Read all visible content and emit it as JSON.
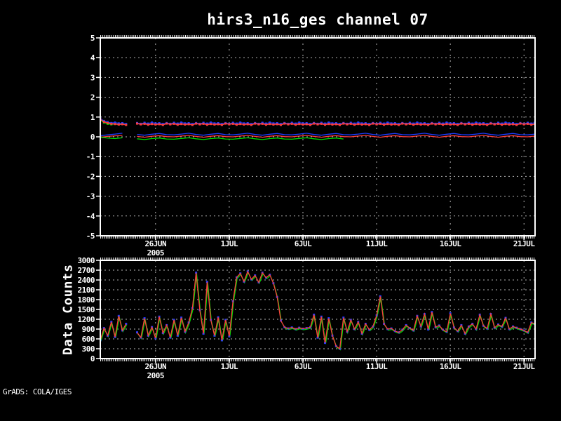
{
  "footer": {
    "grads": "GrADS: COLA/IGES"
  },
  "colors": {
    "background": "#000000",
    "frame": "#ffffff",
    "grid": "#b4b4b4",
    "text": "#ffffff",
    "red": "#fa3c3c",
    "green": "#00dc00",
    "blue": "#1e3cff"
  },
  "chart_data": [
    {
      "id": "ges-departures",
      "type": "line",
      "panel": "top",
      "title": "hirs3_n16_ges channel 07",
      "ylim": [
        -5,
        5
      ],
      "yticks": [
        5,
        4,
        3,
        2,
        1,
        0,
        -1,
        -2,
        -3,
        -4,
        -5
      ],
      "xlim_days": [
        -3.75,
        25.75
      ],
      "xticks": [
        {
          "day": 0,
          "label": "26JUN",
          "sublabel": "2005"
        },
        {
          "day": 5,
          "label": "1JUL"
        },
        {
          "day": 10,
          "label": "6JUL"
        },
        {
          "day": 15,
          "label": "11JUL"
        },
        {
          "day": 20,
          "label": "16JUL"
        },
        {
          "day": 25,
          "label": "21JUL"
        }
      ],
      "grid": true,
      "series": [
        {
          "name": "obs-band-green",
          "color": "#00dc00",
          "line": true,
          "marker": true,
          "x0": -3.75,
          "dx": 0.25,
          "values": [
            0.85,
            0.72,
            0.66,
            0.63,
            0.65,
            0.62,
            0.64,
            0.62
          ]
        },
        {
          "name": "obs-band-blue",
          "color": "#1e3cff",
          "line": true,
          "marker": true,
          "x0": -3.75,
          "dx": 0.25,
          "values": [
            0.92,
            0.8,
            0.74,
            0.7,
            0.72,
            0.68,
            0.69,
            0.65,
            null,
            null,
            0.7,
            0.66,
            0.71,
            0.67,
            0.72,
            0.68,
            0.69,
            0.65,
            0.7,
            0.66,
            0.71,
            0.67,
            0.72,
            0.68,
            0.69,
            0.65,
            0.7,
            0.66,
            0.71,
            0.67,
            0.72,
            0.68,
            0.69,
            0.65,
            0.7,
            0.66,
            0.71,
            0.67,
            0.72,
            0.68,
            0.69,
            0.65,
            0.7,
            0.66,
            0.71,
            0.67,
            0.72,
            0.68,
            0.69,
            0.65,
            0.7,
            0.66,
            0.71,
            0.67,
            0.72,
            0.68,
            0.69,
            0.65,
            0.7,
            0.66,
            0.71,
            0.67,
            0.72,
            0.68,
            0.69,
            0.65,
            0.7,
            0.66,
            0.71,
            0.67,
            0.72,
            0.68,
            0.69,
            0.65,
            0.7,
            0.66,
            0.71,
            0.67,
            0.72,
            0.68,
            0.69,
            0.65,
            0.7,
            0.66,
            0.71,
            0.67,
            0.72,
            0.68,
            0.69,
            0.65,
            0.7,
            0.66,
            0.71,
            0.67,
            0.72,
            0.68,
            0.69,
            0.65,
            0.7,
            0.66,
            0.71,
            0.67,
            0.72,
            0.68,
            0.69,
            0.65,
            0.7,
            0.66,
            0.71,
            0.67,
            0.72,
            0.68,
            0.69,
            0.65,
            0.7,
            0.66,
            0.71,
            0.67,
            0.72
          ]
        },
        {
          "name": "obs-band-red",
          "color": "#fa3c3c",
          "line": true,
          "marker": true,
          "x0": -3.75,
          "dx": 0.25,
          "values": [
            0.88,
            0.76,
            0.7,
            0.66,
            0.65,
            0.62,
            0.64,
            0.6,
            null,
            null,
            0.67,
            0.63,
            0.66,
            0.61,
            0.65,
            0.62,
            0.64,
            0.6,
            0.67,
            0.63,
            0.66,
            0.61,
            0.65,
            0.62,
            0.64,
            0.6,
            0.67,
            0.63,
            0.66,
            0.61,
            0.65,
            0.62,
            0.64,
            0.6,
            0.67,
            0.63,
            0.66,
            0.61,
            0.65,
            0.62,
            0.64,
            0.6,
            0.67,
            0.63,
            0.66,
            0.61,
            0.65,
            0.62,
            0.64,
            0.6,
            0.67,
            0.63,
            0.66,
            0.61,
            0.65,
            0.62,
            0.64,
            0.6,
            0.67,
            0.63,
            0.66,
            0.61,
            0.65,
            0.62,
            0.64,
            0.6,
            0.67,
            0.63,
            0.66,
            0.61,
            0.65,
            0.62,
            0.64,
            0.6,
            0.67,
            0.63,
            0.66,
            0.61,
            0.65,
            0.62,
            0.64,
            0.6,
            0.67,
            0.63,
            0.66,
            0.61,
            0.65,
            0.62,
            0.64,
            0.6,
            0.67,
            0.63,
            0.66,
            0.61,
            0.65,
            0.62,
            0.64,
            0.6,
            0.67,
            0.63,
            0.66,
            0.61,
            0.65,
            0.62,
            0.64,
            0.6,
            0.67,
            0.63,
            0.66,
            0.61,
            0.65,
            0.62,
            0.64,
            0.6,
            0.67,
            0.63,
            0.66,
            0.61,
            0.65
          ]
        },
        {
          "name": "bias-blue",
          "color": "#1e3cff",
          "line": true,
          "marker": false,
          "x0": -3.75,
          "dx": 0.5,
          "values": [
            0.06,
            0.1,
            0.14,
            0.18,
            null,
            0.12,
            0.08,
            0.13,
            0.17,
            0.11,
            0.1,
            0.14,
            0.18,
            0.12,
            0.08,
            0.13,
            0.17,
            0.11,
            0.1,
            0.14,
            0.18,
            0.12,
            0.08,
            0.13,
            0.17,
            0.11,
            0.1,
            0.14,
            0.18,
            0.12,
            0.08,
            0.13,
            0.17,
            0.11,
            0.1,
            0.14,
            0.18,
            0.12,
            0.08,
            0.13,
            0.17,
            0.11,
            0.1,
            0.14,
            0.18,
            0.12,
            0.08,
            0.13,
            0.17,
            0.11,
            0.1,
            0.14,
            0.18,
            0.12,
            0.08,
            0.13,
            0.17,
            0.11,
            0.1,
            0.14
          ]
        },
        {
          "name": "bias-red",
          "color": "#fa3c3c",
          "line": true,
          "marker": false,
          "x0": -3.75,
          "dx": 0.5,
          "values": [
            -0.02,
            0.02,
            0.05,
            0.07,
            null,
            0.02,
            -0.02,
            0.03,
            0.06,
            0.01,
            0,
            0.04,
            0.07,
            0.02,
            -0.02,
            0.03,
            0.06,
            0.01,
            0,
            0.04,
            0.07,
            0.02,
            -0.02,
            0.03,
            0.06,
            0.01,
            0,
            0.04,
            0.07,
            0.02,
            -0.02,
            0.03,
            0.06,
            0.01,
            0,
            0.04,
            0.07,
            0.02,
            -0.02,
            0.03,
            0.06,
            0.01,
            0,
            0.04,
            0.07,
            0.02,
            -0.02,
            0.03,
            0.06,
            0.01,
            0,
            0.04,
            0.07,
            0.02,
            -0.02,
            0.03,
            0.06,
            0.01,
            0,
            0.04
          ]
        },
        {
          "name": "bias-green",
          "color": "#00dc00",
          "line": true,
          "marker": false,
          "x0": -3.75,
          "dx": 0.5,
          "values": [
            -0.02,
            -0.06,
            -0.09,
            -0.05,
            null,
            -0.1,
            -0.14,
            -0.09,
            -0.06,
            -0.11,
            -0.12,
            -0.08,
            -0.05,
            -0.1,
            -0.14,
            -0.09,
            -0.06,
            -0.11,
            -0.12,
            -0.08,
            -0.05,
            -0.1,
            -0.14,
            -0.09,
            -0.06,
            -0.11,
            -0.12,
            -0.08,
            -0.05,
            -0.1,
            -0.14,
            -0.09,
            -0.06,
            -0.11
          ]
        }
      ]
    },
    {
      "id": "data-counts",
      "type": "line",
      "panel": "bottom",
      "ylabel": "Data Counts",
      "ylim": [
        0,
        3000
      ],
      "yticks": [
        3000,
        2700,
        2400,
        2100,
        1800,
        1500,
        1200,
        900,
        600,
        300,
        0
      ],
      "xticks": [
        {
          "day": 0,
          "label": "26JUN",
          "sublabel": "2005"
        },
        {
          "day": 5,
          "label": "1JUL"
        },
        {
          "day": 10,
          "label": "6JUL"
        },
        {
          "day": 15,
          "label": "11JUL"
        },
        {
          "day": 20,
          "label": "16JUL"
        },
        {
          "day": 25,
          "label": "21JUL"
        }
      ],
      "grid": true,
      "series": [
        {
          "name": "counts",
          "color": "#00dc00",
          "line": true,
          "marker": false,
          "x0": -3.75,
          "dx": 0.25,
          "offset": [
            0.8,
            1.5
          ],
          "values": [
            560,
            930,
            700,
            1120,
            660,
            1300,
            860,
            1060,
            null,
            null,
            800,
            640,
            1230,
            700,
            960,
            620,
            1280,
            780,
            1020,
            640,
            1180,
            700,
            1250,
            820,
            1100,
            1540,
            2620,
            1480,
            760,
            2340,
            1180,
            700,
            1260,
            560,
            1180,
            680,
            1750,
            2480,
            2600,
            2350,
            2660,
            2420,
            2540,
            2330,
            2620,
            2470,
            2560,
            2300,
            1880,
            1160,
            960,
            920,
            950,
            900,
            940,
            910,
            930,
            960,
            1340,
            640,
            1280,
            480,
            1230,
            700,
            380,
            300,
            1250,
            820,
            1180,
            900,
            1120,
            760,
            1060,
            880,
            980,
            1320,
            1900,
            1060,
            900,
            920,
            840,
            800,
            880,
            1020,
            930,
            860,
            1300,
            980,
            1360,
            890,
            1420,
            960,
            1010,
            880,
            820,
            1380,
            950,
            840,
            1020,
            760,
            980,
            1060,
            900,
            1340,
            1000,
            920,
            1360,
            940,
            1040,
            980,
            1240,
            900,
            980,
            940,
            900,
            860,
            800,
            1100,
            1060
          ]
        },
        {
          "name": "counts-markers",
          "color": "#1e3cff",
          "line": false,
          "marker": true,
          "x0": -3.75,
          "dx": 0.25,
          "values": "counts"
        },
        {
          "name": "counts-line",
          "color": "#fa3c3c",
          "line": true,
          "marker": false,
          "x0": -3.75,
          "dx": 0.25,
          "values": "counts"
        }
      ]
    }
  ]
}
